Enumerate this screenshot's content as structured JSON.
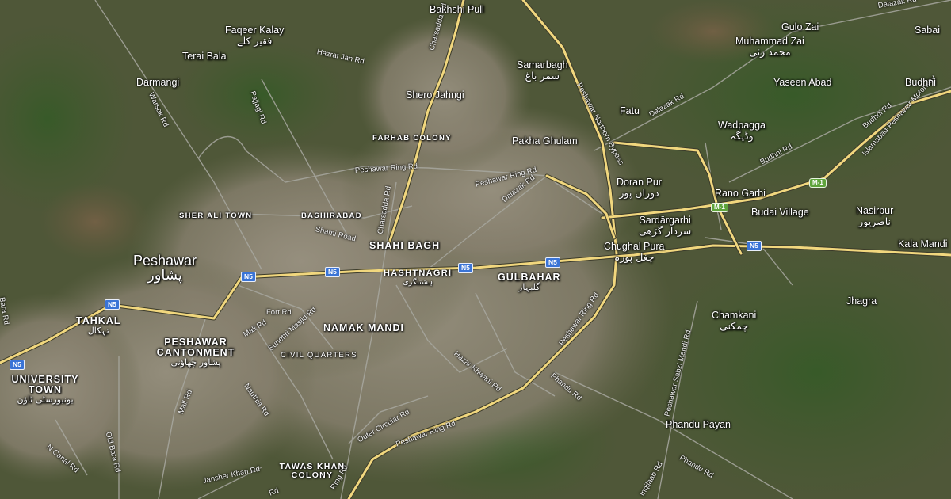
{
  "map": {
    "places": {
      "bakhshi_pull": "Bakhshi Pull",
      "faqeer_kalay": "Faqeer Kalay",
      "faqeer_kalay_ur": "فقیر کلے",
      "terai_bala": "Terai Bala",
      "darmangi": "Darmangi",
      "samarbagh": "Samarbagh",
      "samarbagh_ur": "سمر باغ",
      "shero_jahngi": "Shero Jahngi",
      "gulo_zai": "Gulo Zai",
      "muhammad_zai": "Muhammad Zai",
      "muhammad_zai_ur": "محمد زئی",
      "yaseen_abad": "Yaseen Abad",
      "sabai": "Sabai",
      "budhni": "Budhni",
      "fatu": "Fatu",
      "wadpagga": "Wadpagga",
      "wadpagga_ur": "وڈپگہ",
      "farhab_colony": "FARHAB COLONY",
      "pakha_ghulam": "Pakha Ghulam",
      "doran_pur": "Doran Pur",
      "doran_pur_ur": "دوران پور",
      "rano_garhi": "Rano Garhi",
      "budai_village": "Budai Village",
      "nasirpur": "Nasirpur",
      "nasirpur_ur": "ناصرپور",
      "sher_ali_town": "SHER ALI TOWN",
      "bashirabad": "BASHIRABAD",
      "sardargarhi": "Sardārgarhi",
      "sardargarhi_ur": "سردار گڑھی",
      "kala_mandi": "Kala Mandi",
      "peshawar": "Peshawar",
      "peshawar_ur": "پشاور",
      "shahi_bagh": "SHAHI BAGH",
      "chughal_pura": "Chughal Pura",
      "chughal_pura_ur": "چغل پورہ",
      "hashtnagri": "HASHTNAGRI",
      "hashtnagri_ur": "ہشتنگری",
      "gulbahar": "GULBAHAR",
      "gulbahar_ur": "گلبہار",
      "jhagra": "Jhagra",
      "tahkal": "TAHKAL",
      "tahkal_ur": "تہکال",
      "peshawar_cantonment": "PESHAWAR CANTONMENT",
      "peshawar_cantonment_ur": "پشاور چھاؤنی",
      "namak_mandi": "NAMAK MANDI",
      "chamkani": "Chamkani",
      "chamkani_ur": "چمکنی",
      "civil_quarters": "CIVIL QUARTERS",
      "university_town": "UNIVERSITY TOWN",
      "university_town_ur": "یونیورسٹی ٹاؤن",
      "phandu_payan": "Phandu Payan",
      "tawas_khan_colony": "TAWAS KHAN COLONY"
    },
    "roads": {
      "charsadda_rd_north": "Charsadda Rd",
      "hazrat_jan_rd": "Hazrat Jan Rd",
      "dalazak_rd_ne": "Dalazak Rd",
      "islamabad_peshawar_motorway": "Islamabad-Peshawar Motorway",
      "warsak_rd": "Warsak Rd",
      "pajjagi_rd": "Pajjagi Rd",
      "peshawar_northern_bypass": "Peshawar Northern Bypass",
      "dalazak_rd_mid": "Dalazak Rd",
      "budhni_rd_1": "Budhni Rd",
      "budhni_rd_2": "Budhni Rd",
      "peshawar_ring_rd_nw": "Peshawar Ring Rd",
      "peshawar_ring_rd_n": "Peshawar Ring Rd",
      "dalazak_rd_center": "Dalazak Rd",
      "charsadda_rd_center": "Charsadda Rd",
      "shami_road": "Shami Road",
      "peshawar_ring_rd_e": "Peshawar Ring Rd",
      "fort_rd": "Fort Rd",
      "mall_rd": "Mall Rd",
      "sunehri_masjid_rd": "Sunehri Masjid Rd",
      "peshawar_sabzi_mandi_rd": "Peshawar Sabzi Mandi Rd",
      "hazar_khwani_rd": "Hazar Khwani Rd",
      "phandu_rd_1": "Phandu Rd",
      "nauthia_rd": "Nauthia Rd",
      "mall_rd_south": "Mall Rd",
      "outer_circular_rd": "Outer Circular Rd",
      "peshawar_ring_rd_s": "Peshawar Ring Rd",
      "old_bara_rd": "Old Bara Rd",
      "n_canal_rd": "N Canal Rd",
      "janshei_khan_rd": "Jansher Khan Rd",
      "inqilaab_rd": "Inqilaab Rd",
      "phandu_rd_2": "Phandu Rd",
      "dalazak_rd_top": "Dalazak Rd",
      "ring_rd_bottom": "Ring Rd",
      "rd_bottom_left": "Rd",
      "bara_rd_left": "Bara Rd"
    },
    "shields": {
      "n5": "N5",
      "m1": "M-1"
    },
    "colors": {
      "base": "#4f5738",
      "urban": "#8a8476",
      "vegetation": "#3f5a2c",
      "highway": "#f5e08a",
      "ring_road": "#e8d070",
      "minor_road": "#9a9a9a",
      "n5_shield": "#3a74d6",
      "m1_shield": "#5ea33b"
    }
  }
}
